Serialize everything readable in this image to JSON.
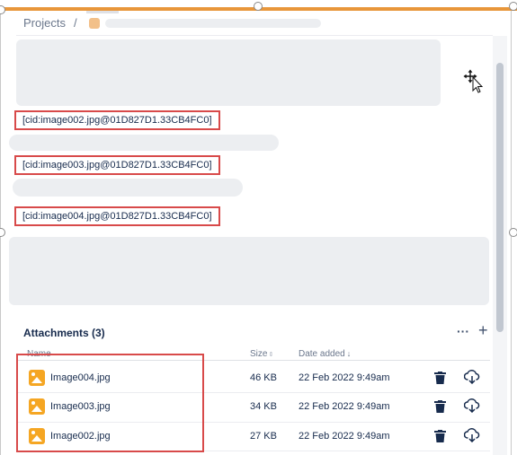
{
  "breadcrumb": {
    "projects": "Projects",
    "separator": "/"
  },
  "inline_images": [
    "[cid:image002.jpg@01D827D1.33CB4FC0]",
    "[cid:image003.jpg@01D827D1.33CB4FC0]",
    "[cid:image004.jpg@01D827D1.33CB4FC0]"
  ],
  "attachments": {
    "title": "Attachments (3)",
    "more_icon": "more-horizontal-icon",
    "add_icon": "plus-icon",
    "columns": {
      "name": "Name",
      "size": "Size",
      "date": "Date added"
    },
    "rows": [
      {
        "name": "Image004.jpg",
        "size": "46 KB",
        "date": "22 Feb 2022 9:49am"
      },
      {
        "name": "Image003.jpg",
        "size": "34 KB",
        "date": "22 Feb 2022 9:49am"
      },
      {
        "name": "Image002.jpg",
        "size": "27 KB",
        "date": "22 Feb 2022 9:49am"
      }
    ]
  },
  "colors": {
    "highlight": "#d84a4a",
    "image_icon": "#f5a623",
    "selection": "#e8963a"
  }
}
